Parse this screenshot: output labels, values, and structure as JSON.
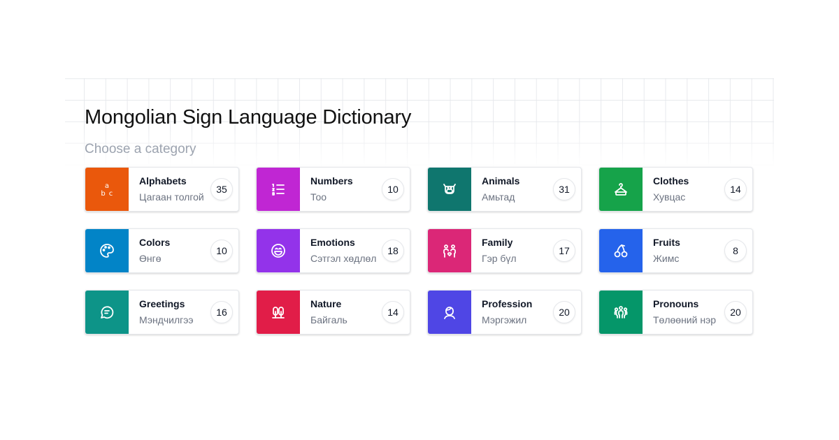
{
  "header": {
    "title": "Mongolian Sign Language Dictionary",
    "subtitle": "Choose a category"
  },
  "categories": [
    {
      "title": "Alphabets",
      "subtitle": "Цагаан толгой",
      "count": "35",
      "color": "#ea580c",
      "icon": "alphabet-icon"
    },
    {
      "title": "Numbers",
      "subtitle": "Тоо",
      "count": "10",
      "color": "#c026d3",
      "icon": "list-numbers-icon"
    },
    {
      "title": "Animals",
      "subtitle": "Амьтад",
      "count": "31",
      "color": "#0f766e",
      "icon": "cow-icon"
    },
    {
      "title": "Clothes",
      "subtitle": "Хувцас",
      "count": "14",
      "color": "#16a34a",
      "icon": "hanger-icon"
    },
    {
      "title": "Colors",
      "subtitle": "Өнгө",
      "count": "10",
      "color": "#0284c7",
      "icon": "palette-icon"
    },
    {
      "title": "Emotions",
      "subtitle": "Сэтгэл хөдлөл",
      "count": "18",
      "color": "#9333ea",
      "icon": "smile-icon"
    },
    {
      "title": "Family",
      "subtitle": "Гэр бүл",
      "count": "17",
      "color": "#db2777",
      "icon": "family-icon"
    },
    {
      "title": "Fruits",
      "subtitle": "Жимс",
      "count": "8",
      "color": "#2563eb",
      "icon": "cherry-icon"
    },
    {
      "title": "Greetings",
      "subtitle": "Мэндчилгээ",
      "count": "16",
      "color": "#0d9488",
      "icon": "chat-bubble-icon"
    },
    {
      "title": "Nature",
      "subtitle": "Байгаль",
      "count": "14",
      "color": "#e11d48",
      "icon": "trees-icon"
    },
    {
      "title": "Profession",
      "subtitle": "Мэргэжил",
      "count": "20",
      "color": "#4f46e5",
      "icon": "person-icon"
    },
    {
      "title": "Pronouns",
      "subtitle": "Төлөөний нэр",
      "count": "20",
      "color": "#059669",
      "icon": "users-group-icon"
    }
  ]
}
